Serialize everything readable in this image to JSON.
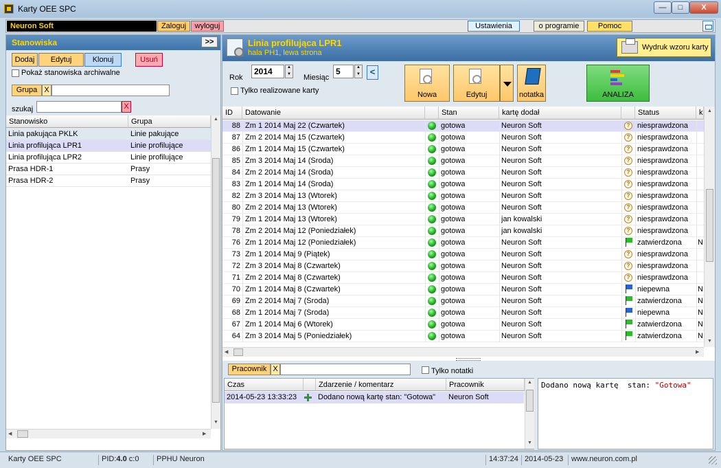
{
  "window": {
    "title": "Karty OEE SPC",
    "min_label": "—",
    "max_label": "□",
    "close_label": "X"
  },
  "topbar": {
    "user": "Neuron  Soft",
    "login": "Zaloguj",
    "logout": "wyloguj",
    "settings": "Ustawienia",
    "about": "o programie",
    "help": "Pomoc"
  },
  "left": {
    "title": "Stanowiska",
    "expand": ">>",
    "add": "Dodaj",
    "edit": "Edytuj",
    "clone": "Klonuj",
    "delete": "Usuń",
    "archive_label": "Pokaż stanowiska archiwalne",
    "group_label": "Grupa",
    "group_clear": "X",
    "group_value": "",
    "search_label": "szukaj",
    "search_value": "",
    "search_clear": "X",
    "columns": [
      "Stanowisko",
      "Grupa"
    ],
    "rows": [
      [
        "Linia pakująca PKLK",
        "Linie pakujące"
      ],
      [
        "Linia profilująca LPR1",
        "Linie profilujące"
      ],
      [
        "Linia profilująca LPR2",
        "Linie profilujące"
      ],
      [
        "Prasa HDR-1",
        "Prasy"
      ],
      [
        "Prasa HDR-2",
        "Prasy"
      ]
    ],
    "selected_row": 1
  },
  "right": {
    "title": "Linia profilująca LPR1",
    "subtitle": "hala PH1, lewa strona",
    "print": "Wydruk wzoru karty",
    "year_label": "Rok",
    "year": "2014",
    "month_label": "Miesiąc",
    "month": "5",
    "prev": "<",
    "realized_label": "Tylko realizowane karty",
    "new": "Nowa",
    "edit": "Edytuj",
    "note": "notatka",
    "analysis": "ANALIZA",
    "columns": [
      "ID",
      "Datowanie",
      "",
      "Stan",
      "kartę dodał",
      "",
      "Status",
      "k"
    ],
    "rows": [
      {
        "id": "88",
        "date": "Zm 1  2014  Maj  22 (Czwartek)",
        "state": "gotowa",
        "author": "Neuron  Soft",
        "mark": "q",
        "status": "niesprawdzona",
        "k": ""
      },
      {
        "id": "87",
        "date": "Zm 2  2014  Maj  15 (Czwartek)",
        "state": "gotowa",
        "author": "Neuron  Soft",
        "mark": "q",
        "status": "niesprawdzona",
        "k": ""
      },
      {
        "id": "86",
        "date": "Zm 1  2014  Maj  15 (Czwartek)",
        "state": "gotowa",
        "author": "Neuron  Soft",
        "mark": "q",
        "status": "niesprawdzona",
        "k": ""
      },
      {
        "id": "85",
        "date": "Zm 3  2014  Maj  14 (Środa)",
        "state": "gotowa",
        "author": "Neuron  Soft",
        "mark": "q",
        "status": "niesprawdzona",
        "k": ""
      },
      {
        "id": "84",
        "date": "Zm 2  2014  Maj  14 (Środa)",
        "state": "gotowa",
        "author": "Neuron  Soft",
        "mark": "q",
        "status": "niesprawdzona",
        "k": ""
      },
      {
        "id": "83",
        "date": "Zm 1  2014  Maj  14 (Środa)",
        "state": "gotowa",
        "author": "Neuron  Soft",
        "mark": "q",
        "status": "niesprawdzona",
        "k": ""
      },
      {
        "id": "82",
        "date": "Zm 3  2014  Maj  13 (Wtorek)",
        "state": "gotowa",
        "author": "Neuron  Soft",
        "mark": "q",
        "status": "niesprawdzona",
        "k": ""
      },
      {
        "id": "80",
        "date": "Zm 2  2014  Maj  13 (Wtorek)",
        "state": "gotowa",
        "author": "Neuron  Soft",
        "mark": "q",
        "status": "niesprawdzona",
        "k": ""
      },
      {
        "id": "79",
        "date": "Zm 1  2014  Maj  13 (Wtorek)",
        "state": "gotowa",
        "author": "jan kowalski",
        "mark": "q",
        "status": "niesprawdzona",
        "k": ""
      },
      {
        "id": "78",
        "date": "Zm 2  2014  Maj  12 (Poniedziałek)",
        "state": "gotowa",
        "author": "jan kowalski",
        "mark": "q",
        "status": "niesprawdzona",
        "k": ""
      },
      {
        "id": "76",
        "date": "Zm 1  2014  Maj  12 (Poniedziałek)",
        "state": "gotowa",
        "author": "Neuron  Soft",
        "mark": "green",
        "status": "zatwierdzona",
        "k": "N"
      },
      {
        "id": "73",
        "date": "Zm 1  2014  Maj  9 (Piątek)",
        "state": "gotowa",
        "author": "Neuron  Soft",
        "mark": "q",
        "status": "niesprawdzona",
        "k": ""
      },
      {
        "id": "72",
        "date": "Zm 3  2014  Maj  8 (Czwartek)",
        "state": "gotowa",
        "author": "Neuron  Soft",
        "mark": "q",
        "status": "niesprawdzona",
        "k": ""
      },
      {
        "id": "71",
        "date": "Zm 2  2014  Maj  8 (Czwartek)",
        "state": "gotowa",
        "author": "Neuron  Soft",
        "mark": "q",
        "status": "niesprawdzona",
        "k": ""
      },
      {
        "id": "70",
        "date": "Zm 1  2014  Maj  8 (Czwartek)",
        "state": "gotowa",
        "author": "Neuron  Soft",
        "mark": "blue",
        "status": "niepewna",
        "k": "N"
      },
      {
        "id": "69",
        "date": "Zm 2  2014  Maj  7 (Środa)",
        "state": "gotowa",
        "author": "Neuron  Soft",
        "mark": "green",
        "status": "zatwierdzona",
        "k": "N"
      },
      {
        "id": "68",
        "date": "Zm 1  2014  Maj  7 (Środa)",
        "state": "gotowa",
        "author": "Neuron  Soft",
        "mark": "blue",
        "status": "niepewna",
        "k": "N"
      },
      {
        "id": "67",
        "date": "Zm 1  2014  Maj  6 (Wtorek)",
        "state": "gotowa",
        "author": "Neuron  Soft",
        "mark": "green",
        "status": "zatwierdzona",
        "k": "N"
      },
      {
        "id": "64",
        "date": "Zm 3  2014  Maj  5 (Poniedziałek)",
        "state": "gotowa",
        "author": "Neuron  Soft",
        "mark": "green",
        "status": "zatwierdzona",
        "k": "N"
      }
    ],
    "selected_row": 0
  },
  "log": {
    "worker_label": "Pracownik",
    "worker_clear": "X",
    "worker_value": "",
    "notes_label": "Tylko notatki",
    "columns": [
      "Czas",
      "Zdarzenie / komentarz",
      "Pracownik"
    ],
    "row": {
      "time": "2014-05-23  13:33:23",
      "event": "Dodano nową kartę  stan: \"Gotowa\"",
      "worker": "Neuron  Soft"
    },
    "detail_prefix": "Dodano nową kartę  stan: ",
    "detail_value": "\"Gotowa\""
  },
  "status": {
    "app": "Karty OEE SPC",
    "pid_label": "PID:",
    "pid_value": "4.0",
    "pid_suffix": " c:0",
    "company": "PPHU Neuron",
    "time": "14:37:24",
    "date": "2014-05-23",
    "url": "www.neuron.com.pl"
  }
}
